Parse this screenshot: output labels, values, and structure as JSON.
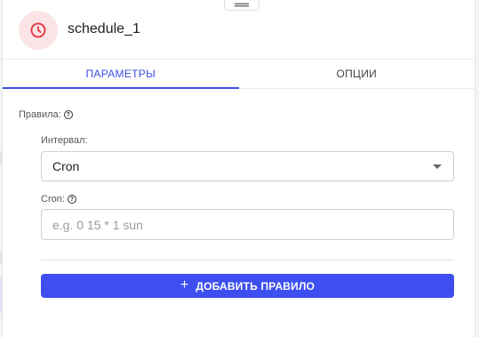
{
  "node": {
    "title": "schedule_1",
    "icon": "clock-icon",
    "accent": "#e5323f",
    "icon_bg": "#fbe4e6"
  },
  "tabs": [
    {
      "label": "ПАРАМЕТРЫ",
      "active": true
    },
    {
      "label": "ОПЦИИ",
      "active": false
    }
  ],
  "rules": {
    "label": "Правила:",
    "interval": {
      "label": "Интервал:",
      "selected": "Cron"
    },
    "cron": {
      "label": "Cron:",
      "value": "",
      "placeholder": "e.g. 0 15 * 1 sun"
    },
    "add_button_label": "ДОБАВИТЬ ПРАВИЛО"
  },
  "colors": {
    "primary": "#3d4ff0",
    "tab_active": "#3b4fe4"
  }
}
